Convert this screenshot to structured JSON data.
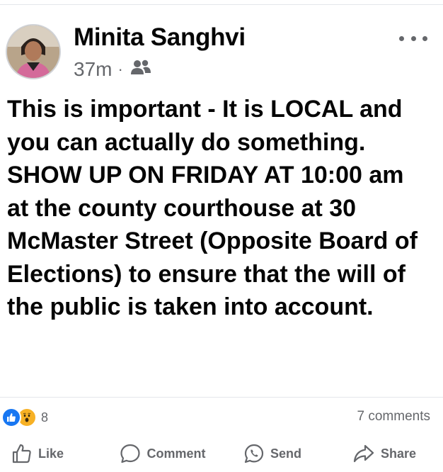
{
  "post": {
    "author": "Minita Sanghvi",
    "timestamp": "37m",
    "separator": "·",
    "audience_icon": "friends-icon",
    "text": "This is important - It is LOCAL and you can actually do something. SHOW UP ON FRIDAY AT 10:00 am at the county courthouse at 30 McMaster Street (Opposite Board of Elections) to ensure that the will of the public is taken into account."
  },
  "engagement": {
    "reactions": [
      "like",
      "wow"
    ],
    "reaction_count": "8",
    "comments": "7 comments"
  },
  "actions": {
    "like": "Like",
    "comment": "Comment",
    "send": "Send",
    "share": "Share"
  },
  "colors": {
    "text": "#050505",
    "secondary": "#65676b",
    "like_blue": "#1877f2",
    "wow_yellow": "#f7b125",
    "divider": "#e4e6eb"
  }
}
